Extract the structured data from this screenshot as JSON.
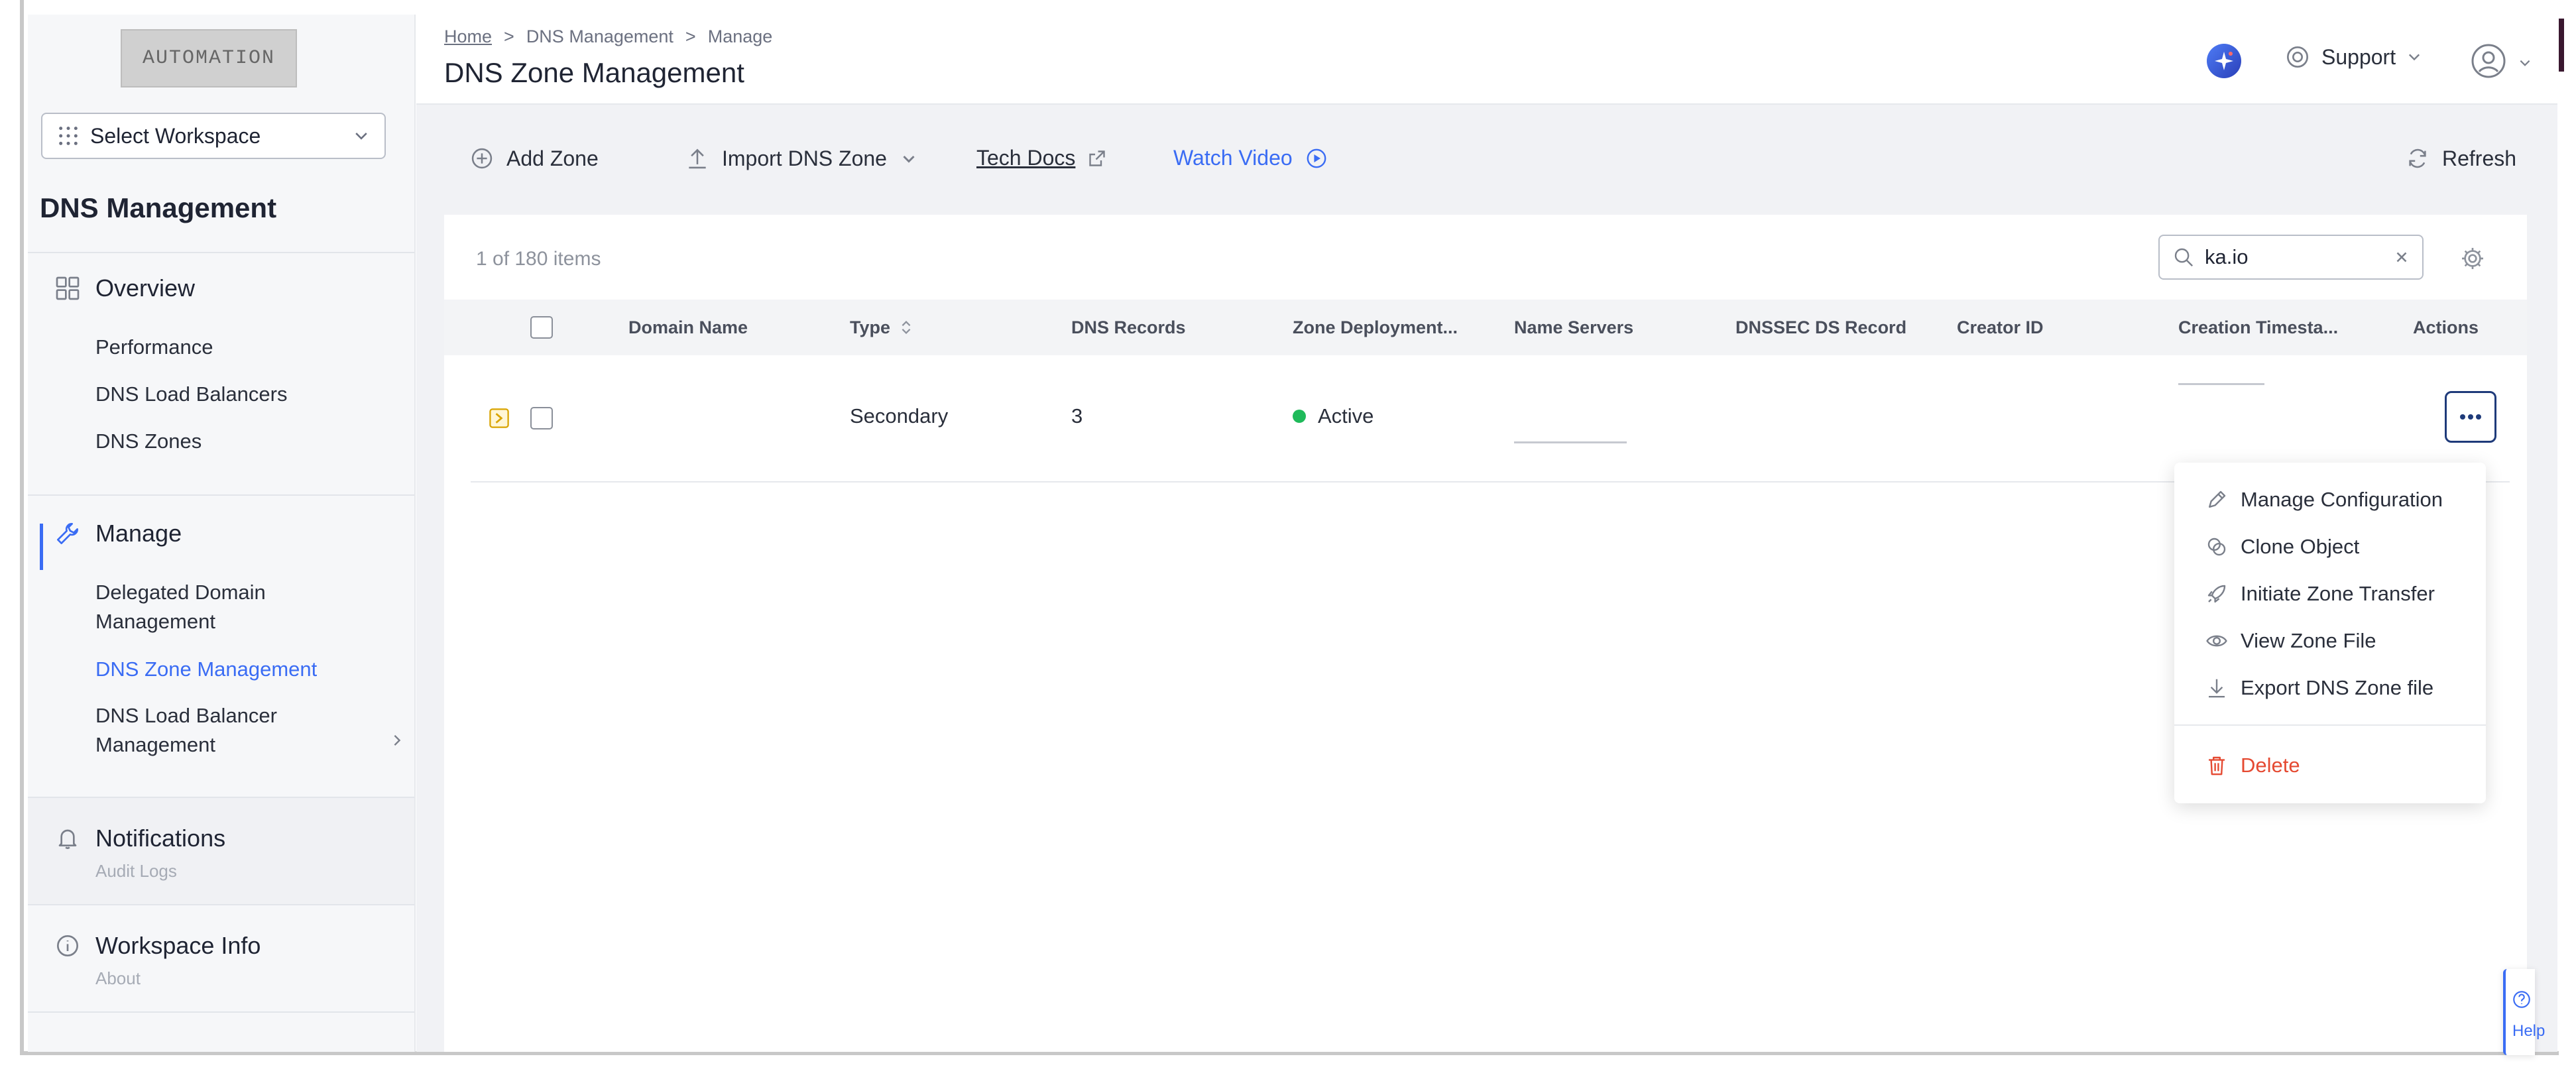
{
  "logo_text": "AUTOMATION",
  "sidebar": {
    "workspace_select": "Select Workspace",
    "title": "DNS Management",
    "overview": {
      "label": "Overview",
      "items": [
        "Performance",
        "DNS Load Balancers",
        "DNS Zones"
      ]
    },
    "manage": {
      "label": "Manage",
      "items": [
        {
          "line1": "Delegated Domain",
          "line2": "Management"
        },
        {
          "line1": "DNS Zone Management"
        },
        {
          "line1": "DNS Load Balancer",
          "line2": "Management"
        }
      ],
      "active_item": "DNS Zone Management"
    },
    "notifications": {
      "label": "Notifications",
      "sub": "Audit Logs"
    },
    "workspace_info": {
      "label": "Workspace Info",
      "sub": "About"
    }
  },
  "header": {
    "breadcrumb": [
      "Home",
      "DNS Management",
      "Manage"
    ],
    "title": "DNS Zone Management",
    "support": "Support"
  },
  "toolbar": {
    "add_zone": "Add Zone",
    "import_zone": "Import DNS Zone",
    "tech_docs": "Tech Docs",
    "watch_video": "Watch Video",
    "refresh": "Refresh"
  },
  "table": {
    "count": "1 of 180 items",
    "search_value": "ka.io",
    "columns": [
      "Domain Name",
      "Type",
      "DNS Records",
      "Zone Deployment...",
      "Name Servers",
      "DNSSEC DS Record",
      "Creator ID",
      "Creation Timesta...",
      "Actions"
    ],
    "rows": [
      {
        "domain_name": "",
        "type": "Secondary",
        "dns_records": "3",
        "zone_deployment": "Active",
        "name_servers": "",
        "dnssec_ds_record": "",
        "creator_id": "",
        "creation_timestamp": ""
      }
    ]
  },
  "actions_menu": {
    "items": [
      "Manage Configuration",
      "Clone Object",
      "Initiate Zone Transfer",
      "View Zone File",
      "Export DNS Zone file"
    ],
    "delete": "Delete"
  },
  "help_tab": "Help",
  "colors": {
    "accent": "#3a6cf4",
    "active_status": "#1fba5a",
    "danger": "#e54a32",
    "sidebar_bg": "#f6f7f9"
  }
}
